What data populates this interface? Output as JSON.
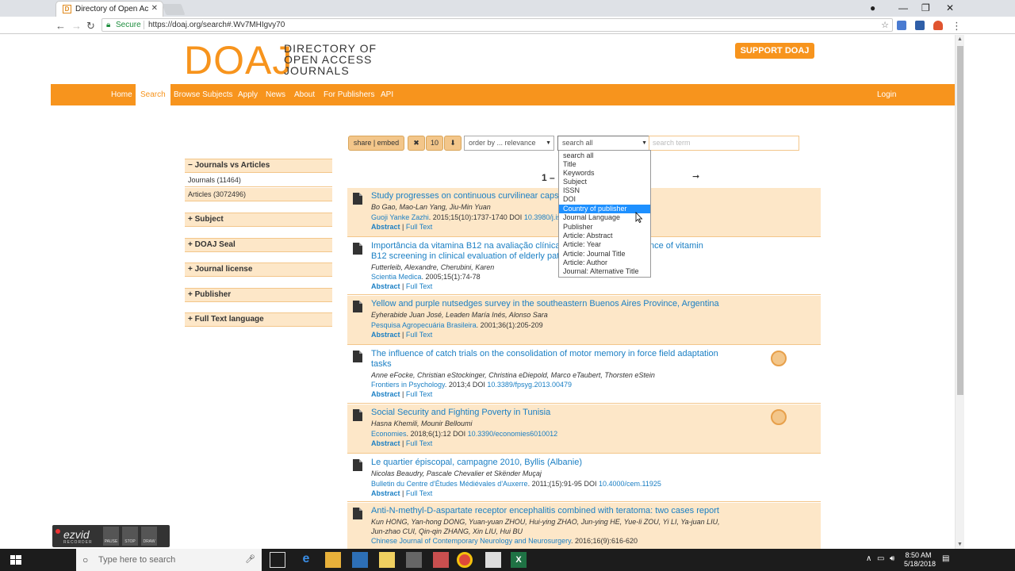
{
  "browser": {
    "tab_title": "Directory of Open Access",
    "tab_favicon": "D",
    "secure_label": "Secure",
    "url": "https://doaj.org/search#.Wv7MHIgvy70"
  },
  "site": {
    "logo_big": "DOAJ",
    "logo_line1": "DIRECTORY OF",
    "logo_line2": "OPEN ACCESS",
    "logo_line3": "JOURNALS",
    "support_label": "SUPPORT DOAJ",
    "nav": [
      "Home",
      "Search",
      "Browse Subjects",
      "Apply",
      "News",
      "About",
      "For Publishers",
      "API"
    ],
    "login": "Login",
    "accent": "#f7941d"
  },
  "controls": {
    "share": "share | embed",
    "clear": "✖",
    "page_size": "10",
    "sort_dir": "⬇",
    "order_by": "order by ... relevance",
    "search_field": "search all",
    "search_placeholder": "search term"
  },
  "dropdown": {
    "options": [
      "search all",
      "Title",
      "Keywords",
      "Subject",
      "ISSN",
      "DOI",
      "Country of publisher",
      "Journal Language",
      "Publisher",
      "Article: Abstract",
      "Article: Year",
      "Article: Journal Title",
      "Article: Author",
      "Journal: Alternative Title"
    ],
    "highlighted": "Country of publisher"
  },
  "facets": {
    "journals_vs_articles": "Journals vs Articles",
    "journals": "Journals (11464)",
    "articles": "Articles (3072496)",
    "subject": "Subject",
    "doaj_seal": "DOAJ Seal",
    "journal_license": "Journal license",
    "publisher": "Publisher",
    "full_text_language": "Full Text language"
  },
  "pager": {
    "text": "1 –",
    "next": "➞"
  },
  "results": [
    {
      "title": "Study progresses on continuous curvilinear capsu",
      "authors": "Bo Gao, Mao-Lan Yang, Jiu-Min Yuan",
      "journal": "Guoji Yanke Zazhi",
      "citation": ". 2015;15(10):1737-1740 DOI ",
      "doi": "10.3980/j.is",
      "abstract": "Abstract",
      "fulltext": "Full Text"
    },
    {
      "title": "Importância da vitamina B12 na avaliação clínica",
      "title_tail": "ortance of vitamin",
      "title_line2": "B12 screening in clinical evaluation of elderly patie",
      "authors": "Futterleib, Alexandre, Cherubini, Karen",
      "journal": "Scientia Medica",
      "citation": ". 2005;15(1):74-78",
      "abstract": "Abstract",
      "fulltext": "Full Text"
    },
    {
      "title": "Yellow and purple nutsedges survey in the southeastern Buenos Aires Province, Argentina",
      "authors": "Eyherabide Juan José, Leaden María Inés, Alonso Sara",
      "journal": "Pesquisa Agropecuária Brasileira",
      "citation": ". 2001;36(1):205-209",
      "abstract": "Abstract",
      "fulltext": "Full Text"
    },
    {
      "title": "The influence of catch trials on the consolidation of motor memory in force field adaptation tasks",
      "authors": "Anne eFocke, Christian eStockinger, Christina eDiepold, Marco eTaubert, Thorsten eStein",
      "journal": "Frontiers in Psychology",
      "citation": ". 2013;4 DOI ",
      "doi": "10.3389/fpsyg.2013.00479",
      "abstract": "Abstract",
      "fulltext": "Full Text"
    },
    {
      "title": "Social Security and Fighting Poverty in Tunisia",
      "authors": "Hasna Khemili, Mounir Belloumi",
      "journal": "Economies",
      "citation": ". 2018;6(1):12 DOI ",
      "doi": "10.3390/economies6010012",
      "abstract": "Abstract",
      "fulltext": "Full Text"
    },
    {
      "title": "Le quartier épiscopal, campagne 2010, Byllis (Albanie)",
      "authors": "Nicolas Beaudry, Pascale Chevalier et Skënder Muçaj",
      "journal": "Bulletin du Centre d'Études Médiévales d'Auxerre",
      "citation": ". 2011;(15):91-95 DOI ",
      "doi": "10.4000/cem.11925",
      "abstract": "Abstract",
      "fulltext": "Full Text"
    },
    {
      "title": "Anti-N-methyl-D-aspartate receptor encephalitis combined with teratoma: two cases report",
      "authors": "Kun HONG, Yan-hong DONG, Yuan-yuan ZHOU, Hui-ying ZHAO, Jun-ying HE, Yue-li ZOU, Yi LI, Ya-juan LIU,",
      "authors2": "Jun-zhao CUI, Qin-qin ZHANG, Xin LIU, Hui BU",
      "journal": "Chinese Journal of Contemporary Neurology and Neurosurgery",
      "citation": ". 2016;16(9):616-620"
    }
  ],
  "recorder": {
    "logo": "ezvid",
    "sub": "RECORDER",
    "pause": "PAUSE",
    "stop": "STOP",
    "draw": "DRAW"
  },
  "taskbar": {
    "search_placeholder": "Type here to search",
    "time": "8:50 AM",
    "date": "5/18/2018"
  }
}
